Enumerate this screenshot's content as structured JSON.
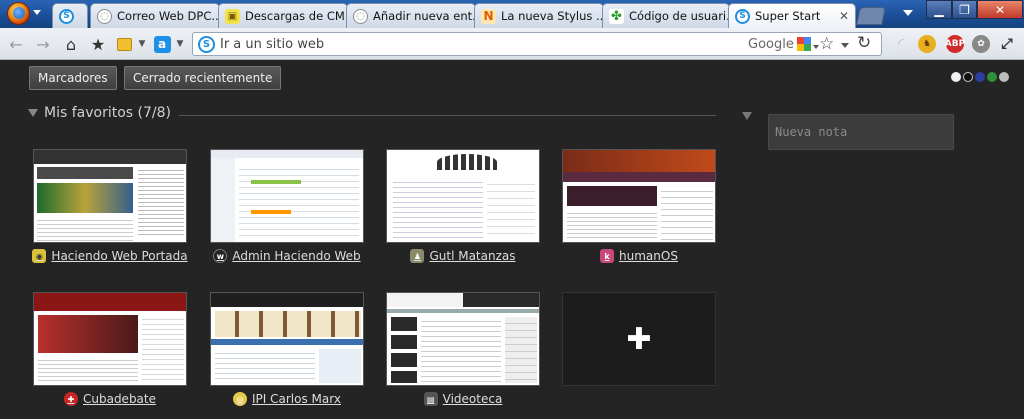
{
  "tabs": [
    {
      "title": "",
      "icon": "super-start-icon"
    },
    {
      "title": "Correo Web DPC...",
      "icon": "globe-icon"
    },
    {
      "title": "Descargas de CM...",
      "icon": "cmd-icon"
    },
    {
      "title": "Añadir nueva ent...",
      "icon": "globe-icon"
    },
    {
      "title": "La nueva Stylus ...",
      "icon": "n-icon"
    },
    {
      "title": "Código de usuari...",
      "icon": "clover-icon"
    },
    {
      "title": "Super Start",
      "icon": "super-start-icon",
      "active": true
    }
  ],
  "window": {
    "min": "▁",
    "max": "❐",
    "close": "✕"
  },
  "address": {
    "placeholder": "Ir a un sitio web",
    "engine": "Google"
  },
  "superstart": {
    "bookmarks_button": "Marcadores",
    "recent_button": "Cerrado recientemente",
    "group_title": "Mis favoritos (7/8)",
    "note_placeholder": "Nueva nota",
    "theme_dots": [
      "#f2f2f2",
      "#111111",
      "#2b3f9e",
      "#2f8f3a",
      "#bdbdbd"
    ],
    "sites": [
      {
        "title": "Haciendo Web Portada"
      },
      {
        "title": "Admin Haciendo Web"
      },
      {
        "title": "Gutl Matanzas"
      },
      {
        "title": "humanOS"
      },
      {
        "title": "Cubadebate"
      },
      {
        "title": "IPI Carlos Marx"
      },
      {
        "title": "Videoteca"
      }
    ],
    "add_glyph": "✚"
  }
}
